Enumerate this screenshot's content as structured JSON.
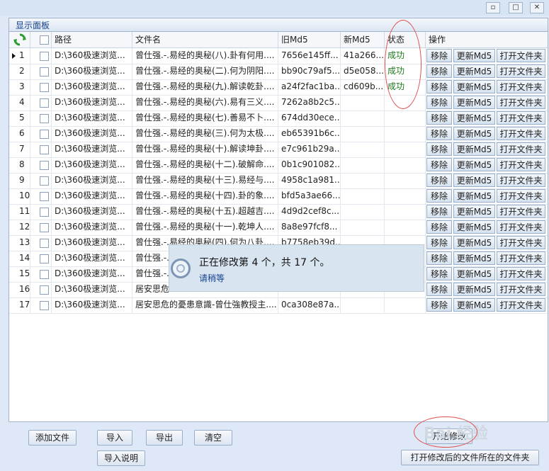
{
  "panel": {
    "title": "显示面板"
  },
  "window": {
    "minimize": "▫",
    "maximize": "□",
    "close": "✕"
  },
  "columns": {
    "path": "路径",
    "filename": "文件名",
    "old_md5": "旧Md5",
    "new_md5": "新Md5",
    "status": "状态",
    "actions": "操作"
  },
  "rows": [
    {
      "num": "1",
      "path": "D:\\360极速浏览...",
      "file": "曾仕强.-.易经的奥秘(八).卦有何用....",
      "old": "7656e145ff...",
      "new": "41a266...",
      "status": "成功"
    },
    {
      "num": "2",
      "path": "D:\\360极速浏览...",
      "file": "曾仕强.-.易经的奥秘(二).何为阴阳....",
      "old": "bb90c79af5...",
      "new": "d5e058...",
      "status": "成功"
    },
    {
      "num": "3",
      "path": "D:\\360极速浏览...",
      "file": "曾仕强.-.易经的奥秘(九).解读乾卦....",
      "old": "a24f2fac1ba...",
      "new": "cd609b...",
      "status": "成功"
    },
    {
      "num": "4",
      "path": "D:\\360极速浏览...",
      "file": "曾仕强.-.易经的奥秘(六).易有三义....",
      "old": "7262a8b2c5...",
      "new": "",
      "status": ""
    },
    {
      "num": "5",
      "path": "D:\\360极速浏览...",
      "file": "曾仕强.-.易经的奥秘(七).善易不卜....",
      "old": "674dd30ece...",
      "new": "",
      "status": ""
    },
    {
      "num": "6",
      "path": "D:\\360极速浏览...",
      "file": "曾仕强.-.易经的奥秘(三).何为太极....",
      "old": "eb65391b6c...",
      "new": "",
      "status": ""
    },
    {
      "num": "7",
      "path": "D:\\360极速浏览...",
      "file": "曾仕强.-.易经的奥秘(十).解读坤卦....",
      "old": "e7c961b29a...",
      "new": "",
      "status": ""
    },
    {
      "num": "8",
      "path": "D:\\360极速浏览...",
      "file": "曾仕强.-.易经的奥秘(十二).破解命....",
      "old": "0b1c901082...",
      "new": "",
      "status": ""
    },
    {
      "num": "9",
      "path": "D:\\360极速浏览...",
      "file": "曾仕强.-.易经的奥秘(十三).易经与....",
      "old": "4958c1a981...",
      "new": "",
      "status": ""
    },
    {
      "num": "10",
      "path": "D:\\360极速浏览...",
      "file": "曾仕强.-.易经的奥秘(十四).卦的象....",
      "old": "bfd5a3ae66...",
      "new": "",
      "status": ""
    },
    {
      "num": "11",
      "path": "D:\\360极速浏览...",
      "file": "曾仕强.-.易经的奥秘(十五).超越吉....",
      "old": "4d9d2cef8c...",
      "new": "",
      "status": ""
    },
    {
      "num": "12",
      "path": "D:\\360极速浏览...",
      "file": "曾仕强.-.易经的奥秘(十一).乾坤人....",
      "old": "8a8e97fcf8...",
      "new": "",
      "status": ""
    },
    {
      "num": "13",
      "path": "D:\\360极速浏览...",
      "file": "曾仕强.-.易经的奥秘(四).何为八卦....",
      "old": "b7758eb39d...",
      "new": "",
      "status": ""
    },
    {
      "num": "14",
      "path": "D:\\360极速浏览...",
      "file": "曾仕强.-.",
      "old": "",
      "new": "",
      "status": ""
    },
    {
      "num": "15",
      "path": "D:\\360极速浏览...",
      "file": "曾仕强.-.",
      "old": "",
      "new": "",
      "status": ""
    },
    {
      "num": "16",
      "path": "D:\\360极速浏览...",
      "file": "居安思危",
      "old": "",
      "new": "",
      "status": ""
    },
    {
      "num": "17",
      "path": "D:\\360极速浏览...",
      "file": "居安思危的憂患意識-曾仕強教授主....",
      "old": "0ca308e87a...",
      "new": "",
      "status": ""
    }
  ],
  "row_buttons": {
    "remove": "移除",
    "update": "更新Md5",
    "open": "打开文件夹"
  },
  "progress": {
    "message": "正在修改第 4 个，共 17 个。",
    "sub": "请稍等"
  },
  "buttons": {
    "add": "添加文件",
    "import": "导入",
    "export": "导出",
    "clear": "清空",
    "import_help": "导入说明",
    "start": "开始修改",
    "open_modified": "打开修改后的文件所在的文件夹"
  },
  "watermark": "Bai 经验"
}
